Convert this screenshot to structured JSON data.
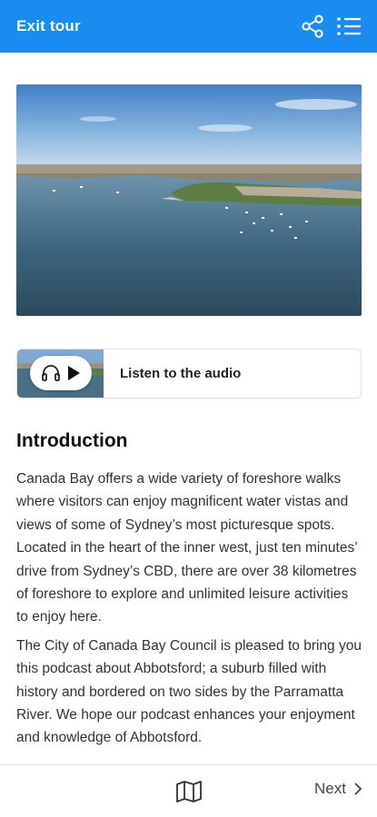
{
  "header": {
    "exit_label": "Exit tour",
    "share_icon": "share-icon",
    "list_icon": "list-icon",
    "background_color": "#1a8cf0"
  },
  "audio": {
    "label": "Listen to the audio",
    "headphones_icon": "headphones-icon",
    "play_icon": "play-icon"
  },
  "content": {
    "heading": "Introduction",
    "paragraphs": [
      "Canada Bay offers a wide variety of foreshore walks where visitors can enjoy magnificent water vistas and views of some of Sydney’s most picturesque spots. Located in the heart of the inner west, just ten minutes’ drive from Sydney’s CBD, there are over 38 kilometres of foreshore to explore and unlimited leisure activities to enjoy here.",
      "The City of Canada Bay Council is pleased to bring you this podcast about Abbotsford; a suburb filled with history and bordered on two sides by the Parramatta River. We hope our podcast enhances your enjoyment and knowledge of Abbotsford."
    ]
  },
  "footer": {
    "map_icon": "map-icon",
    "next_label": "Next",
    "next_icon": "chevron-right-icon"
  }
}
